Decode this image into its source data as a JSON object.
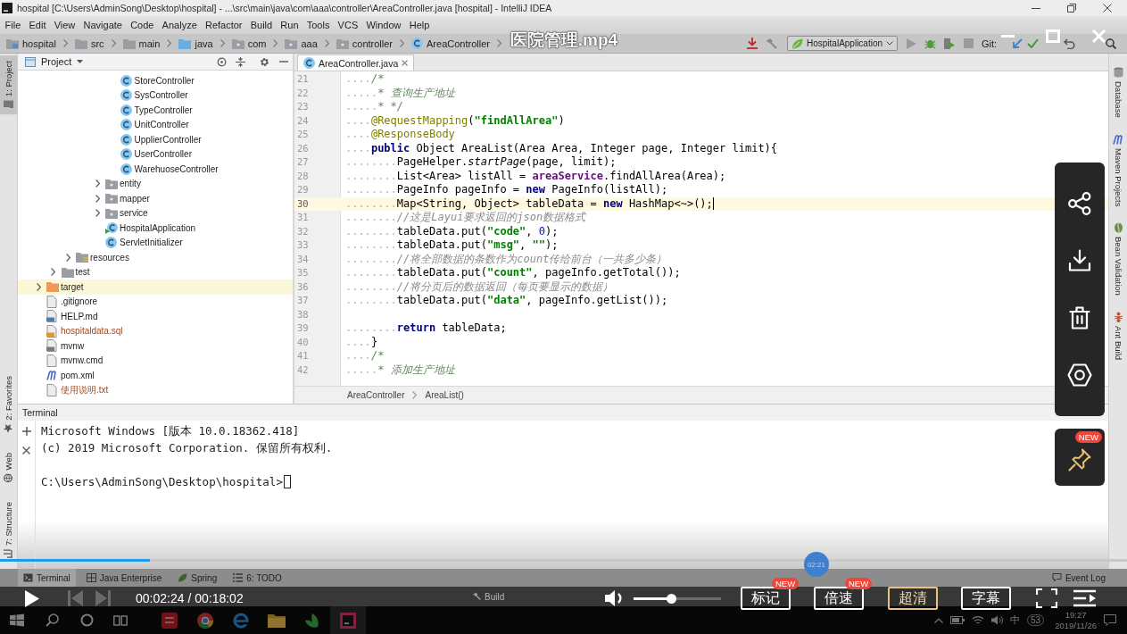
{
  "ide": {
    "title": "hospital [C:\\Users\\AdminSong\\Desktop\\hospital] - ...\\src\\main\\java\\com\\aaa\\controller\\AreaController.java [hospital] - IntelliJ IDEA",
    "menu": [
      "File",
      "Edit",
      "View",
      "Navigate",
      "Code",
      "Analyze",
      "Refactor",
      "Build",
      "Run",
      "Tools",
      "VCS",
      "Window",
      "Help"
    ],
    "breadcrumbs": [
      {
        "label": "hospital",
        "kind": "module"
      },
      {
        "label": "src",
        "kind": "folder"
      },
      {
        "label": "main",
        "kind": "folder"
      },
      {
        "label": "java",
        "kind": "source-folder"
      },
      {
        "label": "com",
        "kind": "package"
      },
      {
        "label": "aaa",
        "kind": "package"
      },
      {
        "label": "controller",
        "kind": "package"
      },
      {
        "label": "AreaController",
        "kind": "class"
      }
    ],
    "toolbar": {
      "run_config": "HospitalApplication",
      "vcs": "Git:"
    },
    "left_tools_top": [
      {
        "label": "1: Project",
        "kind": "project",
        "selected": true
      }
    ],
    "left_tools_bottom": [
      {
        "label": "2: Favorites",
        "kind": "favorites",
        "selected": false
      },
      {
        "label": "Web",
        "kind": "web",
        "selected": false
      },
      {
        "label": "7: Structure",
        "kind": "structure",
        "selected": false
      }
    ],
    "right_tools": [
      {
        "label": "Database",
        "kind": "database"
      },
      {
        "label": "Maven Projects",
        "kind": "maven"
      },
      {
        "label": "Bean Validation",
        "kind": "bean"
      },
      {
        "label": "Ant Build",
        "kind": "ant"
      }
    ],
    "project": {
      "title": "Project",
      "tree": [
        {
          "children": [
            {
              "children": [
                {
                  "children": [
                    {
                      "children": [
                        {
                          "children": [
                            {
                              "label": "StoreController",
                              "kind": "class",
                              "selected": false,
                              "unversioned": false
                            },
                            {
                              "label": "SysController",
                              "kind": "class",
                              "selected": false,
                              "unversioned": false
                            },
                            {
                              "label": "TypeController",
                              "kind": "class",
                              "selected": false,
                              "unversioned": false
                            },
                            {
                              "label": "UnitController",
                              "kind": "class",
                              "selected": false,
                              "unversioned": false
                            },
                            {
                              "label": "UpplierController",
                              "kind": "class",
                              "selected": false,
                              "unversioned": false
                            },
                            {
                              "label": "UserController",
                              "kind": "class",
                              "selected": false,
                              "unversioned": false
                            },
                            {
                              "label": "WarehuoseController",
                              "kind": "class",
                              "selected": false,
                              "unversioned": false
                            }
                          ]
                        },
                        {
                          "label": "entity",
                          "kind": "package",
                          "expanded": false,
                          "selected": false,
                          "unversioned": false
                        },
                        {
                          "label": "mapper",
                          "kind": "package",
                          "expanded": false,
                          "selected": false,
                          "unversioned": false
                        },
                        {
                          "label": "service",
                          "kind": "package",
                          "expanded": false,
                          "selected": false,
                          "unversioned": false
                        },
                        {
                          "label": "HospitalApplication",
                          "kind": "boot-class",
                          "selected": false,
                          "unversioned": false
                        },
                        {
                          "label": "ServletInitializer",
                          "kind": "class",
                          "selected": false,
                          "unversioned": false
                        }
                      ]
                    }
                  ]
                },
                {
                  "label": "resources",
                  "kind": "resources-folder",
                  "expanded": false,
                  "selected": false,
                  "unversioned": false
                }
              ]
            },
            {
              "label": "test",
              "kind": "folder",
              "expanded": false,
              "selected": false,
              "unversioned": false
            }
          ]
        },
        {
          "label": "target",
          "kind": "excluded-folder",
          "expanded": false,
          "selected": true,
          "unversioned": false
        },
        {
          "label": ".gitignore",
          "kind": "text-file",
          "selected": false,
          "unversioned": false
        },
        {
          "label": "HELP.md",
          "kind": "markdown-file",
          "selected": false,
          "unversioned": false
        },
        {
          "label": "hospitaldata.sql",
          "kind": "sql-file",
          "selected": false,
          "unversioned": true
        },
        {
          "label": "mvnw",
          "kind": "script-file",
          "selected": false,
          "unversioned": false
        },
        {
          "label": "mvnw.cmd",
          "kind": "text-file",
          "selected": false,
          "unversioned": false
        },
        {
          "label": "pom.xml",
          "kind": "maven-file",
          "selected": false,
          "unversioned": false
        },
        {
          "label": "使用说明.txt",
          "kind": "text-file",
          "selected": false,
          "unversioned": true
        }
      ]
    },
    "editor": {
      "tabs": [
        {
          "label": "AreaController.java",
          "selected": true
        }
      ],
      "lines": [
        {
          "number": "21",
          "current": false,
          "tokens": [
            {
              "text": "    /*",
              "kind": "block-comment"
            }
          ]
        },
        {
          "number": "22",
          "current": false,
          "tokens": [
            {
              "text": "     * 查询生产地址",
              "kind": "block-comment"
            }
          ]
        },
        {
          "number": "23",
          "current": false,
          "tokens": [
            {
              "text": "     * */",
              "kind": "block-comment"
            }
          ]
        },
        {
          "number": "24",
          "current": false,
          "tokens": [
            {
              "text": "    @RequestMapping",
              "kind": "annotation"
            },
            {
              "text": "(",
              "kind": "plain"
            },
            {
              "text": "\"findAllArea\"",
              "kind": "string"
            },
            {
              "text": ")",
              "kind": "plain"
            }
          ]
        },
        {
          "number": "25",
          "current": false,
          "tokens": [
            {
              "text": "    @ResponseBody",
              "kind": "annotation"
            }
          ]
        },
        {
          "number": "26",
          "current": false,
          "tokens": [
            {
              "text": "    public",
              "kind": "keyword"
            },
            {
              "text": " Object AreaList(Area Area, Integer page, Integer limit){",
              "kind": "plain"
            }
          ]
        },
        {
          "number": "27",
          "current": false,
          "tokens": [
            {
              "text": "        PageHelper.",
              "kind": "plain"
            },
            {
              "text": "startPage",
              "kind": "static-call"
            },
            {
              "text": "(page, limit);",
              "kind": "plain"
            }
          ]
        },
        {
          "number": "28",
          "current": false,
          "tokens": [
            {
              "text": "        List<Area> listAll = ",
              "kind": "plain"
            },
            {
              "text": "areaService",
              "kind": "field"
            },
            {
              "text": ".findAllArea(Area);",
              "kind": "plain"
            }
          ]
        },
        {
          "number": "29",
          "current": false,
          "tokens": [
            {
              "text": "        PageInfo pageInfo = ",
              "kind": "plain"
            },
            {
              "text": "new",
              "kind": "keyword"
            },
            {
              "text": " PageInfo(listAll);",
              "kind": "plain"
            }
          ]
        },
        {
          "number": "30",
          "current": true,
          "tokens": [
            {
              "text": "        Map<String, Object> tableData = ",
              "kind": "plain"
            },
            {
              "text": "new",
              "kind": "keyword"
            },
            {
              "text": " HashMap<~>();",
              "kind": "plain"
            }
          ]
        },
        {
          "number": "31",
          "current": false,
          "tokens": [
            {
              "text": "        //这是Layui要求返回的json数据格式",
              "kind": "line-comment"
            }
          ]
        },
        {
          "number": "32",
          "current": false,
          "tokens": [
            {
              "text": "        tableData.put(",
              "kind": "plain"
            },
            {
              "text": "\"code\"",
              "kind": "string"
            },
            {
              "text": ", ",
              "kind": "plain"
            },
            {
              "text": "0",
              "kind": "number"
            },
            {
              "text": ");",
              "kind": "plain"
            }
          ]
        },
        {
          "number": "33",
          "current": false,
          "tokens": [
            {
              "text": "        tableData.put(",
              "kind": "plain"
            },
            {
              "text": "\"msg\"",
              "kind": "string"
            },
            {
              "text": ", ",
              "kind": "plain"
            },
            {
              "text": "\"\"",
              "kind": "string"
            },
            {
              "text": ");",
              "kind": "plain"
            }
          ]
        },
        {
          "number": "34",
          "current": false,
          "tokens": [
            {
              "text": "        //将全部数据的条数作为count传给前台（一共多少条）",
              "kind": "line-comment"
            }
          ]
        },
        {
          "number": "35",
          "current": false,
          "tokens": [
            {
              "text": "        tableData.put(",
              "kind": "plain"
            },
            {
              "text": "\"count\"",
              "kind": "string"
            },
            {
              "text": ", pageInfo.getTotal());",
              "kind": "plain"
            }
          ]
        },
        {
          "number": "36",
          "current": false,
          "tokens": [
            {
              "text": "        //将分页后的数据返回（每页要显示的数据）",
              "kind": "line-comment"
            }
          ]
        },
        {
          "number": "37",
          "current": false,
          "tokens": [
            {
              "text": "        tableData.put(",
              "kind": "plain"
            },
            {
              "text": "\"data\"",
              "kind": "string"
            },
            {
              "text": ", pageInfo.getList());",
              "kind": "plain"
            }
          ]
        },
        {
          "number": "38",
          "current": false
        },
        {
          "number": "39",
          "current": false,
          "tokens": [
            {
              "text": "        return",
              "kind": "keyword"
            },
            {
              "text": " tableData;",
              "kind": "plain"
            }
          ]
        },
        {
          "number": "40",
          "current": false,
          "tokens": [
            {
              "text": "    }",
              "kind": "plain"
            }
          ]
        },
        {
          "number": "41",
          "current": false,
          "tokens": [
            {
              "text": "    /*",
              "kind": "block-comment"
            }
          ]
        },
        {
          "number": "42",
          "current": false,
          "tokens": [
            {
              "text": "     * 添加生产地址",
              "kind": "block-comment"
            }
          ]
        }
      ],
      "breadcrumbs": [
        "AreaController",
        "AreaList()"
      ]
    },
    "terminal": {
      "title": "Terminal",
      "output": [
        "Microsoft Windows [版本 10.0.18362.418]",
        "(c) 2019 Microsoft Corporation. 保留所有权利."
      ],
      "prompt": "C:\\Users\\AdminSong\\Desktop\\hospital>"
    },
    "tool_tabs": [
      {
        "label": "Terminal",
        "kind": "terminal",
        "selected": true
      },
      {
        "label": "Java Enterprise",
        "kind": "java-enterprise",
        "selected": false
      },
      {
        "label": "Spring",
        "kind": "spring",
        "selected": false
      },
      {
        "label": "6: TODO",
        "kind": "todo",
        "selected": false
      }
    ],
    "event_log": "Event Log",
    "status": {
      "build": "Build"
    },
    "taskbar": {
      "apps": [
        {
          "kind": "tile",
          "active": false
        },
        {
          "kind": "round-browser",
          "active": false
        },
        {
          "kind": "e-browser",
          "active": false
        },
        {
          "kind": "folder",
          "active": false
        },
        {
          "kind": "leaf-app",
          "active": false
        },
        {
          "kind": "ide",
          "active": true
        }
      ],
      "tray": {
        "ime": "中",
        "counter": "53",
        "time": "19:27",
        "date": "2019/11/26"
      }
    }
  },
  "player": {
    "title": "医院管理.mp4",
    "playing": false,
    "time": "00:02:24 / 00:18:02",
    "progress": {
      "level": 0.133
    },
    "hover_time": "02:21",
    "volume": {
      "level": 0.43
    },
    "buttons": [
      {
        "label": "标记",
        "badge": "NEW",
        "selected": false
      },
      {
        "label": "倍速",
        "badge": "NEW",
        "selected": false
      },
      {
        "label": "超清",
        "selected": true
      },
      {
        "label": "字幕",
        "selected": false
      }
    ],
    "side_actions": [
      {
        "kind": "share"
      },
      {
        "kind": "download"
      },
      {
        "kind": "delete"
      },
      {
        "kind": "settings"
      }
    ],
    "pin": {
      "badge": "NEW"
    }
  }
}
